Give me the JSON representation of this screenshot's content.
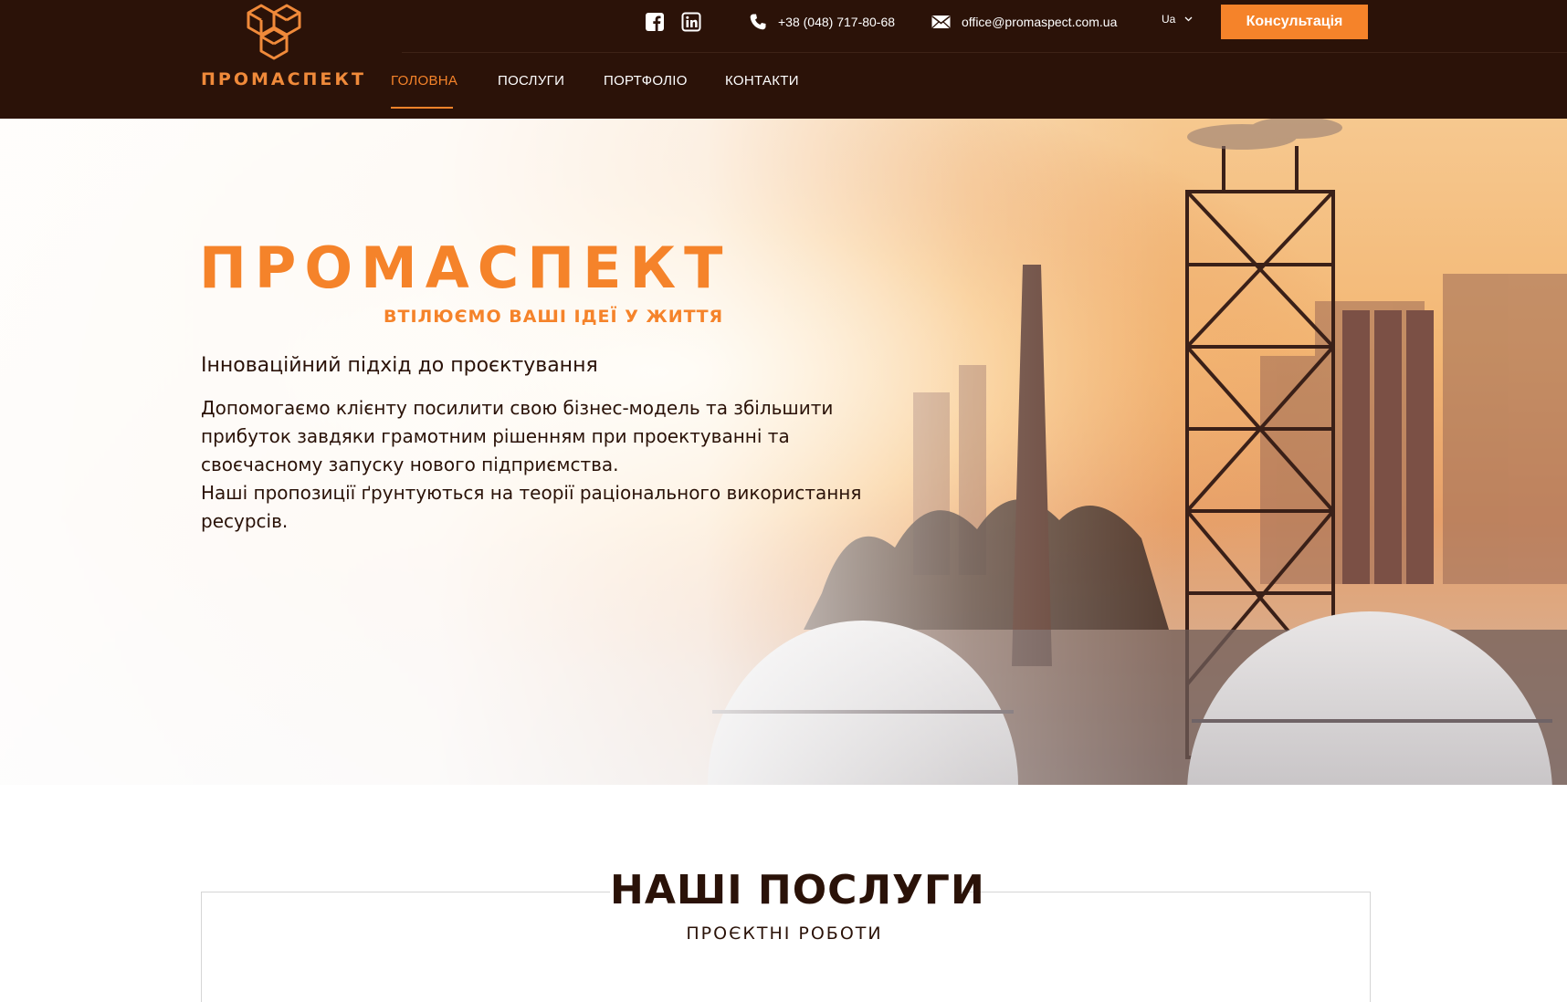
{
  "brand": {
    "logo_text": "ПРОМАСПЕКТ",
    "hero_title": "ПРОМАСПЕКТ",
    "tagline": "ВТІЛЮЄМО ВАШІ ІДЕЇ У ЖИТТЯ"
  },
  "topbar": {
    "social": [
      "facebook-icon",
      "linkedin-icon"
    ],
    "phone": "+38 (048) 717-80-68",
    "email": "office@promaspect.com.ua",
    "language": "Ua",
    "cta_label": "Консультація"
  },
  "nav": {
    "items": [
      {
        "label": "ГОЛОВНА",
        "active": true
      },
      {
        "label": "ПОСЛУГИ",
        "active": false
      },
      {
        "label": "ПОРТФОЛІО",
        "active": false
      },
      {
        "label": "КОНТАКТИ",
        "active": false
      }
    ]
  },
  "hero": {
    "subtitle": "Інноваційний підхід до проєктування",
    "paragraph1": "Допомогаємо клієнту посилити свою бізнес-модель та збільшити прибуток завдяки грамотним рішенням при проектуванні та своєчасному запуску нового підприємства.",
    "paragraph2": "Наші пропозиції ґрунтуються на теорії раціонального використання ресурсів."
  },
  "services": {
    "title": "НАШІ ПОСЛУГИ",
    "subtitle": "ПРОЄКТНІ РОБОТИ"
  },
  "colors": {
    "header_bg": "#2b1208",
    "accent": "#f5832a",
    "text_dark": "#2a1208"
  }
}
